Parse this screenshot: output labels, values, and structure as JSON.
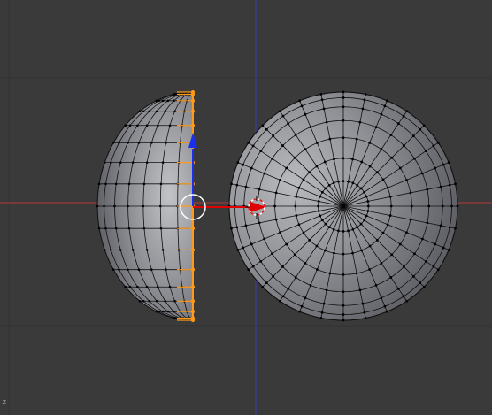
{
  "viewport": {
    "background": "#3a3a3a",
    "grid_color": "#333333",
    "x_axis_color": "#b33a3a",
    "y_axis_color": "#3a3ab3",
    "corner_axis_label": "z"
  },
  "objects": [
    {
      "name": "half-sphere-side-view",
      "type": "hemisphere-mesh",
      "mode": "edit",
      "selected_edge": "cut-plane"
    },
    {
      "name": "hemisphere-front-view",
      "type": "hemisphere-mesh",
      "mode": "edit"
    }
  ],
  "colors": {
    "mesh_fill_light": "#b5b6ba",
    "mesh_fill_dark": "#525359",
    "wire": "#101010",
    "vertex": "#000000",
    "selected_vertex": "#ff9a1a",
    "gizmo_x": "#e00000",
    "gizmo_z": "#1a2ef0",
    "pivot_ring": "#ffffff",
    "cursor_3d": "#e02020"
  },
  "icons": {
    "manipulator": "translate-manipulator-icon",
    "cursor": "3d-cursor-icon"
  }
}
